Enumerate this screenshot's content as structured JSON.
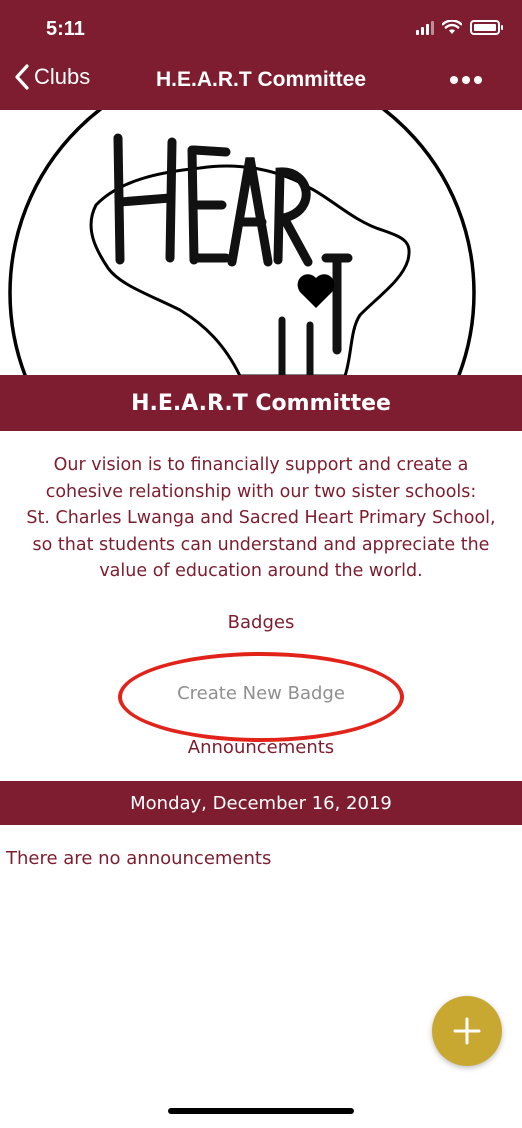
{
  "status_bar": {
    "time": "5:11"
  },
  "nav": {
    "back_label": "Clubs",
    "title": "H.E.A.R.T Committee"
  },
  "banner": {
    "logo_text": "HEART"
  },
  "club": {
    "title": "H.E.A.R.T Committee",
    "description_lines": [
      "Our vision is to financially support and create a",
      "cohesive relationship with our two sister schools:",
      "St. Charles Lwanga and Sacred Heart Primary School,",
      "so that students can understand and appreciate the",
      "value of education around the world."
    ],
    "badges_label": "Badges",
    "create_badge_label": "Create New Badge",
    "announcements_label": "Announcements"
  },
  "announcements": {
    "date": "Monday, December 16, 2019",
    "empty_text": "There are no announcements"
  },
  "colors": {
    "brand": "#7d1d2f",
    "fab": "#c9a832",
    "highlight": "#e2231a"
  },
  "icons": {
    "back": "chevron-left-icon",
    "more": "ellipsis-icon",
    "fab": "plus-icon"
  }
}
